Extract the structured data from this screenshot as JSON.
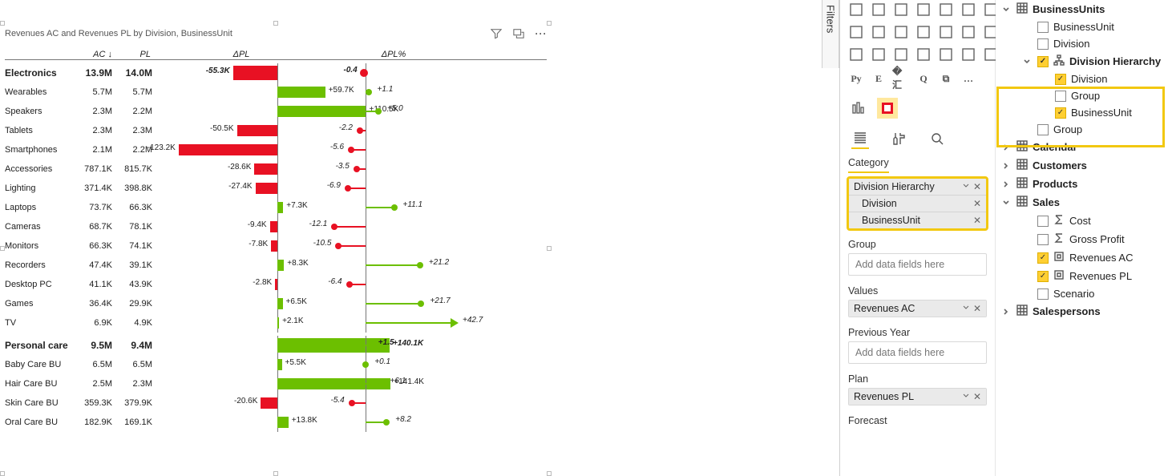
{
  "filters_tab": "Filters",
  "chart": {
    "title": "Revenues AC and Revenues PL by Division, BusinessUnit",
    "headers": {
      "ac": "AC ↓",
      "pl": "PL",
      "dpl": "ΔPL",
      "dpl_pct": "ΔPL%"
    }
  },
  "chart_data": {
    "type": "bar",
    "groups": [
      {
        "label": "Electronics",
        "total": {
          "ac": "13.9M",
          "pl": "14.0M",
          "dpl_label": "-55.3K",
          "dpl_val": -55.3,
          "pct_label": "-0.4",
          "pct_val": -0.4
        },
        "rows": [
          {
            "label": "Wearables",
            "ac": "5.7M",
            "pl": "5.7M",
            "dpl_label": "+59.7K",
            "dpl_val": 59.7,
            "pct_label": "+1.1",
            "pct_val": 1.1
          },
          {
            "label": "Speakers",
            "ac": "2.3M",
            "pl": "2.2M",
            "dpl_label": "+110.5K",
            "dpl_val": 110.5,
            "pct_label": "+5.0",
            "pct_val": 5.0
          },
          {
            "label": "Tablets",
            "ac": "2.3M",
            "pl": "2.3M",
            "dpl_label": "-50.5K",
            "dpl_val": -50.5,
            "pct_label": "-2.2",
            "pct_val": -2.2
          },
          {
            "label": "Smartphones",
            "ac": "2.1M",
            "pl": "2.2M",
            "dpl_label": "-123.2K",
            "dpl_val": -123.2,
            "pct_label": "-5.6",
            "pct_val": -5.6
          },
          {
            "label": "Accessories",
            "ac": "787.1K",
            "pl": "815.7K",
            "dpl_label": "-28.6K",
            "dpl_val": -28.6,
            "pct_label": "-3.5",
            "pct_val": -3.5
          },
          {
            "label": "Lighting",
            "ac": "371.4K",
            "pl": "398.8K",
            "dpl_label": "-27.4K",
            "dpl_val": -27.4,
            "pct_label": "-6.9",
            "pct_val": -6.9
          },
          {
            "label": "Laptops",
            "ac": "73.7K",
            "pl": "66.3K",
            "dpl_label": "+7.3K",
            "dpl_val": 7.3,
            "pct_label": "+11.1",
            "pct_val": 11.1
          },
          {
            "label": "Cameras",
            "ac": "68.7K",
            "pl": "78.1K",
            "dpl_label": "-9.4K",
            "dpl_val": -9.4,
            "pct_label": "-12.1",
            "pct_val": -12.1
          },
          {
            "label": "Monitors",
            "ac": "66.3K",
            "pl": "74.1K",
            "dpl_label": "-7.8K",
            "dpl_val": -7.8,
            "pct_label": "-10.5",
            "pct_val": -10.5
          },
          {
            "label": "Recorders",
            "ac": "47.4K",
            "pl": "39.1K",
            "dpl_label": "+8.3K",
            "dpl_val": 8.3,
            "pct_label": "+21.2",
            "pct_val": 21.2
          },
          {
            "label": "Desktop PC",
            "ac": "41.1K",
            "pl": "43.9K",
            "dpl_label": "-2.8K",
            "dpl_val": -2.8,
            "pct_label": "-6.4",
            "pct_val": -6.4
          },
          {
            "label": "Games",
            "ac": "36.4K",
            "pl": "29.9K",
            "dpl_label": "+6.5K",
            "dpl_val": 6.5,
            "pct_label": "+21.7",
            "pct_val": 21.7
          },
          {
            "label": "TV",
            "ac": "6.9K",
            "pl": "4.9K",
            "dpl_label": "+2.1K",
            "dpl_val": 2.1,
            "pct_label": "+42.7",
            "pct_val": 42.7,
            "outlier": true
          }
        ]
      },
      {
        "label": "Personal care",
        "total": {
          "ac": "9.5M",
          "pl": "9.4M",
          "dpl_label": "+140.1K",
          "dpl_val": 140.1,
          "pct_label": "+1.5",
          "pct_val": 1.5
        },
        "rows": [
          {
            "label": "Baby Care BU",
            "ac": "6.5M",
            "pl": "6.5M",
            "dpl_label": "+5.5K",
            "dpl_val": 5.5,
            "pct_label": "+0.1",
            "pct_val": 0.1
          },
          {
            "label": "Hair Care BU",
            "ac": "2.5M",
            "pl": "2.3M",
            "dpl_label": "+141.4K",
            "dpl_val": 141.4,
            "pct_label": "+6.1",
            "pct_val": 6.1
          },
          {
            "label": "Skin Care BU",
            "ac": "359.3K",
            "pl": "379.9K",
            "dpl_label": "-20.6K",
            "dpl_val": -20.6,
            "pct_label": "-5.4",
            "pct_val": -5.4
          },
          {
            "label": "Oral Care BU",
            "ac": "182.9K",
            "pl": "169.1K",
            "dpl_label": "+13.8K",
            "dpl_val": 13.8,
            "pct_label": "+8.2",
            "pct_val": 8.2
          }
        ]
      }
    ],
    "dpl_scale": 150,
    "pct_scale": 25
  },
  "vis_pane": {
    "tab_active": "Category",
    "wells": {
      "category": {
        "label": "Category",
        "items": [
          "Division Hierarchy",
          "Division",
          "BusinessUnit"
        ]
      },
      "group": {
        "label": "Group",
        "placeholder": "Add data fields here"
      },
      "values": {
        "label": "Values",
        "items": [
          "Revenues AC"
        ]
      },
      "prevyear": {
        "label": "Previous Year",
        "placeholder": "Add data fields here"
      },
      "plan": {
        "label": "Plan",
        "items": [
          "Revenues PL"
        ]
      },
      "forecast": {
        "label": "Forecast"
      }
    }
  },
  "fields": {
    "tables": [
      {
        "name": "BusinessUnits",
        "expanded": true,
        "children": [
          {
            "name": "BusinessUnit",
            "checked": false
          },
          {
            "name": "Division",
            "checked": false
          },
          {
            "name": "Division Hierarchy",
            "checked": true,
            "hierarchy": true,
            "expanded": true,
            "children": [
              {
                "name": "Division",
                "checked": true
              },
              {
                "name": "Group",
                "checked": false
              },
              {
                "name": "BusinessUnit",
                "checked": true
              }
            ]
          },
          {
            "name": "Group",
            "checked": false
          }
        ]
      },
      {
        "name": "Calendar",
        "expanded": false
      },
      {
        "name": "Customers",
        "expanded": false
      },
      {
        "name": "Products",
        "expanded": false
      },
      {
        "name": "Sales",
        "expanded": true,
        "children": [
          {
            "name": "Cost",
            "checked": false,
            "sigma": true
          },
          {
            "name": "Gross Profit",
            "checked": false,
            "sigma": true
          },
          {
            "name": "Revenues AC",
            "checked": true,
            "measure": true
          },
          {
            "name": "Revenues PL",
            "checked": true,
            "measure": true
          },
          {
            "name": "Scenario",
            "checked": false
          }
        ]
      },
      {
        "name": "Salespersons",
        "expanded": false
      }
    ]
  }
}
